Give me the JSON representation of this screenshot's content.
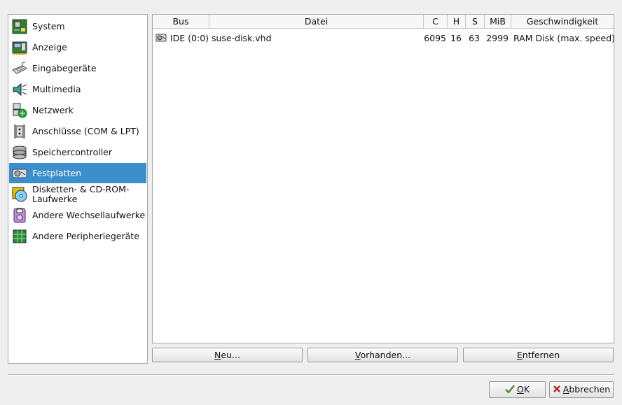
{
  "sidebar": {
    "items": [
      {
        "label": "System",
        "icon": "system-board-icon",
        "name": "sidebar-item-system"
      },
      {
        "label": "Anzeige",
        "icon": "display-card-icon",
        "name": "sidebar-item-anzeige"
      },
      {
        "label": "Eingabegeräte",
        "icon": "keyboard-icon",
        "name": "sidebar-item-eingabegeraete"
      },
      {
        "label": "Multimedia",
        "icon": "speaker-icon",
        "name": "sidebar-item-multimedia"
      },
      {
        "label": "Netzwerk",
        "icon": "network-icon",
        "name": "sidebar-item-netzwerk"
      },
      {
        "label": "Anschlüsse (COM & LPT)",
        "icon": "port-connector-icon",
        "name": "sidebar-item-anschluesse"
      },
      {
        "label": "Speichercontroller",
        "icon": "storage-controller-icon",
        "name": "sidebar-item-speichercontroller"
      },
      {
        "label": "Festplatten",
        "icon": "hard-disk-icon",
        "name": "sidebar-item-festplatten",
        "selected": true
      },
      {
        "label": "Disketten- & CD-ROM-\nLaufwerke",
        "icon": "cd-rom-icon",
        "name": "sidebar-item-disketten-cdrom"
      },
      {
        "label": "Andere Wechsellaufwerke",
        "icon": "removable-drive-icon",
        "name": "sidebar-item-wechsellaufwerke"
      },
      {
        "label": "Andere Peripheriegeräte",
        "icon": "peripheral-chip-icon",
        "name": "sidebar-item-peripherie"
      }
    ]
  },
  "disks": {
    "columns": [
      "Bus",
      "Datei",
      "C",
      "H",
      "S",
      "MiB",
      "Geschwindigkeit"
    ],
    "rows": [
      {
        "bus": "IDE (0:0)",
        "file": "suse-disk.vhd",
        "c": "6095",
        "h": "16",
        "s": "63",
        "mib": "2999",
        "speed": "RAM Disk (max. speed)",
        "icon": "hard-disk-icon"
      }
    ]
  },
  "actions": {
    "new_label_u": "N",
    "new_label_rest": "eu...",
    "existing_label_u": "V",
    "existing_label_rest": "orhanden...",
    "remove_label_u": "E",
    "remove_label_rest": "ntfernen"
  },
  "dialog": {
    "ok_label_u": "O",
    "ok_label_rest": "K",
    "cancel_label_u": "A",
    "cancel_label_rest": "bbrechen"
  },
  "colors": {
    "selection": "#3b8fcb",
    "border": "#a9a9a9",
    "background": "#efefef"
  }
}
